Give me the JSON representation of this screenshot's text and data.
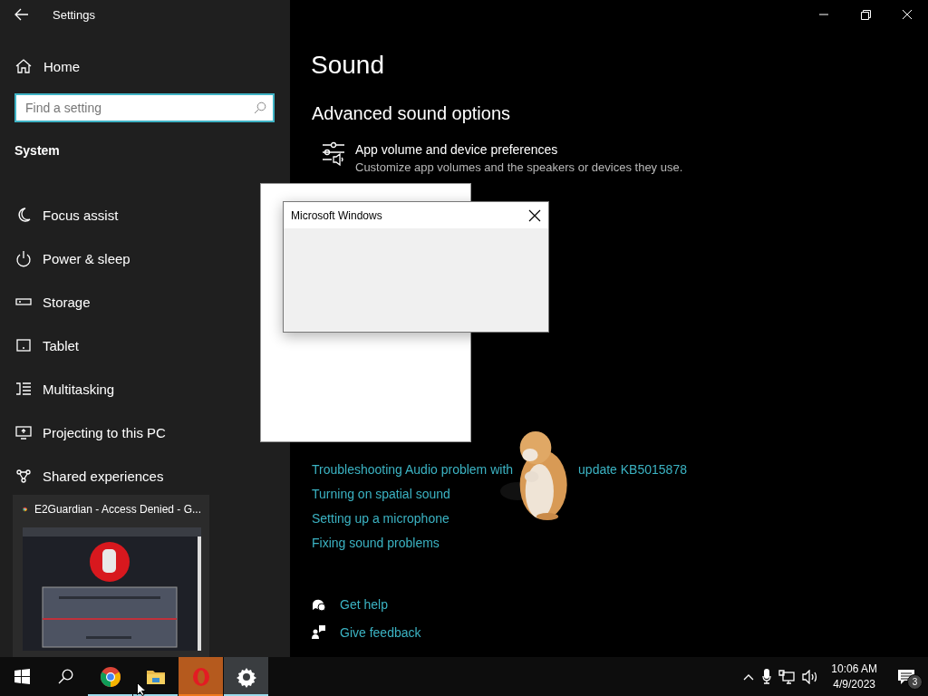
{
  "window": {
    "title": "Settings"
  },
  "sidebar": {
    "home": "Home",
    "search": {
      "placeholder": "Find a setting"
    },
    "section": "System",
    "items": [
      {
        "label": "Focus assist"
      },
      {
        "label": "Power & sleep"
      },
      {
        "label": "Storage"
      },
      {
        "label": "Tablet"
      },
      {
        "label": "Multitasking"
      },
      {
        "label": "Projecting to this PC"
      },
      {
        "label": "Shared experiences"
      }
    ]
  },
  "page": {
    "title": "Sound",
    "section": "Advanced sound options",
    "option": {
      "title": "App volume and device preferences",
      "description": "Customize app volumes and the speakers or devices they use."
    },
    "links": [
      {
        "text": "Troubleshooting Audio problem with",
        "text_after": "update KB5015878"
      },
      {
        "text": "Turning on spatial sound"
      },
      {
        "text": "Setting up a microphone"
      },
      {
        "text": "Fixing sound problems"
      }
    ],
    "help": [
      {
        "label": "Get help"
      },
      {
        "label": "Give feedback"
      }
    ]
  },
  "dialog": {
    "title": "Microsoft Windows"
  },
  "thumbnail": {
    "title": "E2Guardian - Access Denied - G..."
  },
  "taskbar": {
    "apps": [
      {
        "kind": "chrome",
        "running": true,
        "selected": false,
        "flashing": false
      },
      {
        "kind": "explorer",
        "running": true,
        "selected": false,
        "flashing": false
      },
      {
        "kind": "opera",
        "running": true,
        "selected": false,
        "flashing": true
      },
      {
        "kind": "settings",
        "running": true,
        "selected": true,
        "flashing": false
      }
    ],
    "clock": {
      "time": "10:06 AM",
      "date": "4/9/2023"
    },
    "notifications": "3"
  }
}
